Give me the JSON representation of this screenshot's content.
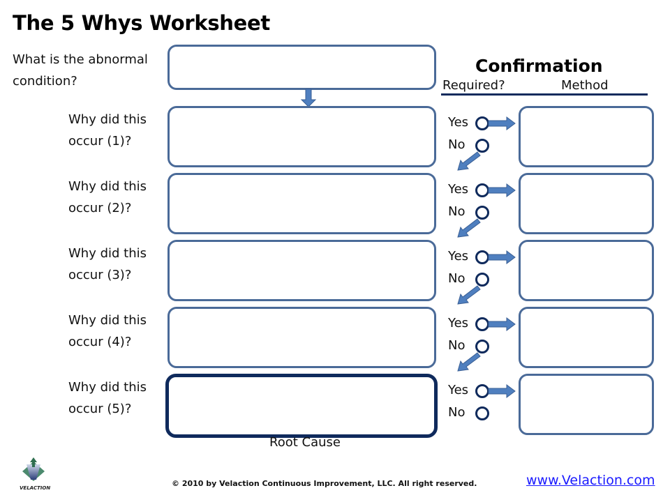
{
  "title": "The 5 Whys Worksheet",
  "abnormal_condition": {
    "label_line1": "What is the abnormal",
    "label_line2": "condition?",
    "value": ""
  },
  "confirmation": {
    "title": "Confirmation",
    "required_label": "Required?",
    "method_label": "Method"
  },
  "whys": [
    {
      "line1": "Why did this",
      "line2": "occur (1)?",
      "value": "",
      "yes_label": "Yes",
      "no_label": "No",
      "method": ""
    },
    {
      "line1": "Why did this",
      "line2": "occur (2)?",
      "value": "",
      "yes_label": "Yes",
      "no_label": "No",
      "method": ""
    },
    {
      "line1": "Why did this",
      "line2": "occur (3)?",
      "value": "",
      "yes_label": "Yes",
      "no_label": "No",
      "method": ""
    },
    {
      "line1": "Why did this",
      "line2": "occur (4)?",
      "value": "",
      "yes_label": "Yes",
      "no_label": "No",
      "method": ""
    },
    {
      "line1": "Why did this",
      "line2": "occur (5)?",
      "value": "",
      "yes_label": "Yes",
      "no_label": "No",
      "method": ""
    }
  ],
  "root_cause_label": "Root Cause",
  "footer": {
    "logo_text": "VELACTION",
    "copyright": "© 2010 by Velaction Continuous Improvement, LLC.  All right reserved.",
    "link": "www.Velaction.com"
  },
  "colors": {
    "box_border": "#4a6a98",
    "root_border": "#0f2a5c",
    "arrow_fill": "#4f7fbf",
    "link": "#1a1aff"
  }
}
